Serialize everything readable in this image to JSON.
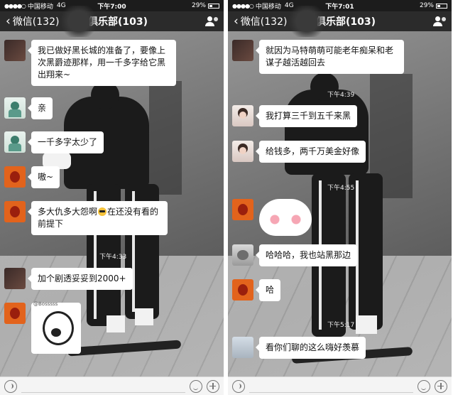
{
  "left": {
    "status": {
      "carrier": "中国移动",
      "network": "4G",
      "time": "下午7:00",
      "battery": "29%"
    },
    "nav": {
      "back_label": "微信(132)",
      "title": "长评俱乐部(103)"
    },
    "messages": [
      {
        "avatar": "dark-photo",
        "text": "我已做好黑长城的准备了，要像上次黑爵迹那样，用一千多字给它黑出翔来~"
      },
      {
        "avatar": "cartoon",
        "text": "亲"
      },
      {
        "avatar": "cartoon",
        "text": "一千多字太少了"
      },
      {
        "avatar": "orange-bird",
        "text": "嗷~"
      },
      {
        "avatar": "orange-bird",
        "text_before": "多大仇多大怨啊",
        "emoji": "sunglasses",
        "text_after": "在还没有看的前提下"
      },
      {
        "avatar": "dark-photo",
        "text": "加个剧透妥妥到2000+"
      }
    ],
    "timestamp": "下午4:33",
    "sticker_caption": "@Bosssss"
  },
  "right": {
    "status": {
      "carrier": "中国移动",
      "network": "4G",
      "time": "下午7:01",
      "battery": "29%"
    },
    "nav": {
      "back_label": "微信(132)",
      "title": "长评俱乐部(103)"
    },
    "messages": [
      {
        "avatar": "dark-photo",
        "text": "就因为马特萌萌可能老年痴呆和老谋子越活越回去"
      },
      {
        "avatar": "girl",
        "text": "我打算三千到五千来黑"
      },
      {
        "avatar": "girl",
        "text": "给钱多，两千万美金好像"
      },
      {
        "avatar": "cat",
        "text": "哈哈哈，我也站黑那边"
      },
      {
        "avatar": "orange-bird",
        "text": "哈"
      },
      {
        "avatar": "old-man",
        "text": "看你们聊的这么嗨好羡慕"
      }
    ],
    "timestamps": [
      "下午4:39",
      "下午4:55",
      "下午5:17"
    ]
  },
  "colors": {
    "nav_bg": "#2b2b2b",
    "bubble_bg": "#ffffff",
    "toolbar_bg": "#f4f4f4"
  },
  "icons": [
    "back-chevron-icon",
    "group-members-icon",
    "voice-icon",
    "emoji-icon",
    "plus-icon"
  ]
}
